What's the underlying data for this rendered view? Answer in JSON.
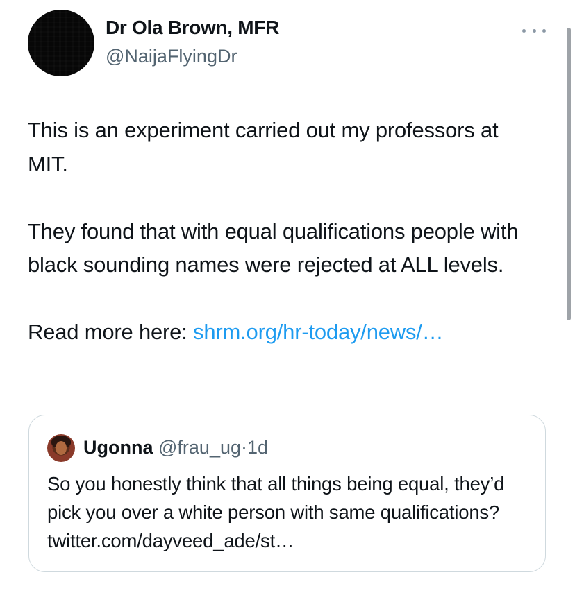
{
  "tweet": {
    "author_name": "Dr Ola Brown, MFR",
    "author_handle": "@NaijaFlyingDr",
    "more_icon": "more-horizontal-icon",
    "paragraphs": [
      "This is an experiment carried out my professors at MIT.",
      "They found that with equal qualifications people with black sounding names were rejected at ALL levels."
    ],
    "read_more_prefix": "Read more here: ",
    "read_more_link": "shrm.org/hr-today/news/…"
  },
  "quote": {
    "author_name": "Ugonna",
    "author_handle": "@frau_ug",
    "separator": "·",
    "time": "1d",
    "text": "So you honestly think that all things being equal, they’d pick you over a white person with same qualifications? twitter.com/dayveed_ade/st…"
  },
  "colors": {
    "text": "#0f1419",
    "secondary_text": "#536471",
    "link": "#1d9bf0",
    "border": "#cfd9de"
  }
}
